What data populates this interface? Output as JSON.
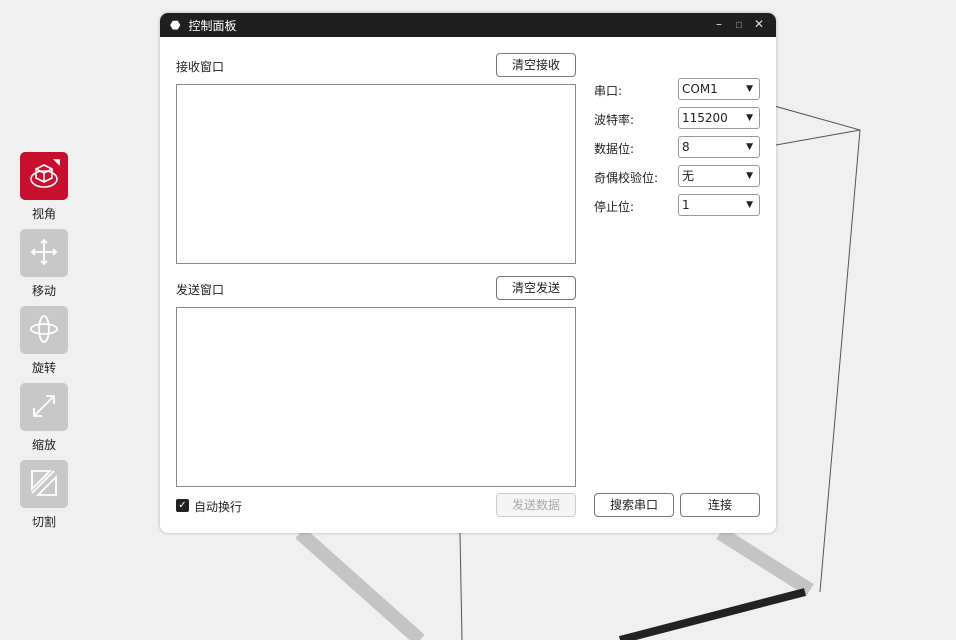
{
  "toolbar": {
    "items": [
      {
        "label": "视角",
        "icon": "view-cube-icon",
        "active": true
      },
      {
        "label": "移动",
        "icon": "move-arrows-icon"
      },
      {
        "label": "旋转",
        "icon": "rotate-icon"
      },
      {
        "label": "缩放",
        "icon": "scale-icon"
      },
      {
        "label": "切割",
        "icon": "cut-icon"
      }
    ]
  },
  "dialog": {
    "title": "控制面板",
    "receive": {
      "label": "接收窗口",
      "clear_label": "清空接收",
      "value": ""
    },
    "send": {
      "label": "发送窗口",
      "clear_label": "清空发送",
      "value": "",
      "send_label": "发送数据"
    },
    "auto_wrap": {
      "label": "自动换行",
      "checked": true
    },
    "settings": [
      {
        "label": "串口:",
        "value": "COM1"
      },
      {
        "label": "波特率:",
        "value": "115200"
      },
      {
        "label": "数据位:",
        "value": "8"
      },
      {
        "label": "奇偶校验位:",
        "value": "无"
      },
      {
        "label": "停止位:",
        "value": "1"
      }
    ],
    "search_label": "搜索串口",
    "connect_label": "连接"
  },
  "colors": {
    "accent": "#c8102e",
    "titlebar": "#1f1f1f"
  }
}
